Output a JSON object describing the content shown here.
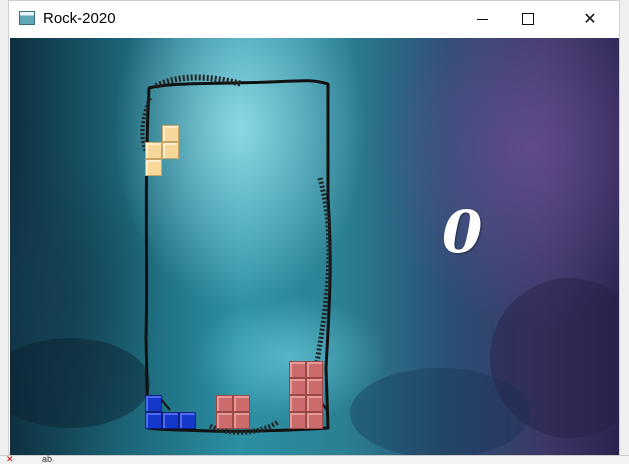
{
  "window": {
    "title": "Rock-2020",
    "minimize_icon": "minimize-icon",
    "maximize_icon": "maximize-icon",
    "close_icon": "close-icon"
  },
  "game": {
    "score": "0",
    "active_piece": {
      "color": "#f7d79a",
      "shape": "S-tetromino (vertical)"
    },
    "stack": [
      {
        "color": "#1438c9",
        "label": "blue piece"
      },
      {
        "color": "#cc6b6b",
        "label": "red pieces"
      }
    ]
  },
  "taskbar": {
    "item1": "✕",
    "item2": "ab"
  }
}
